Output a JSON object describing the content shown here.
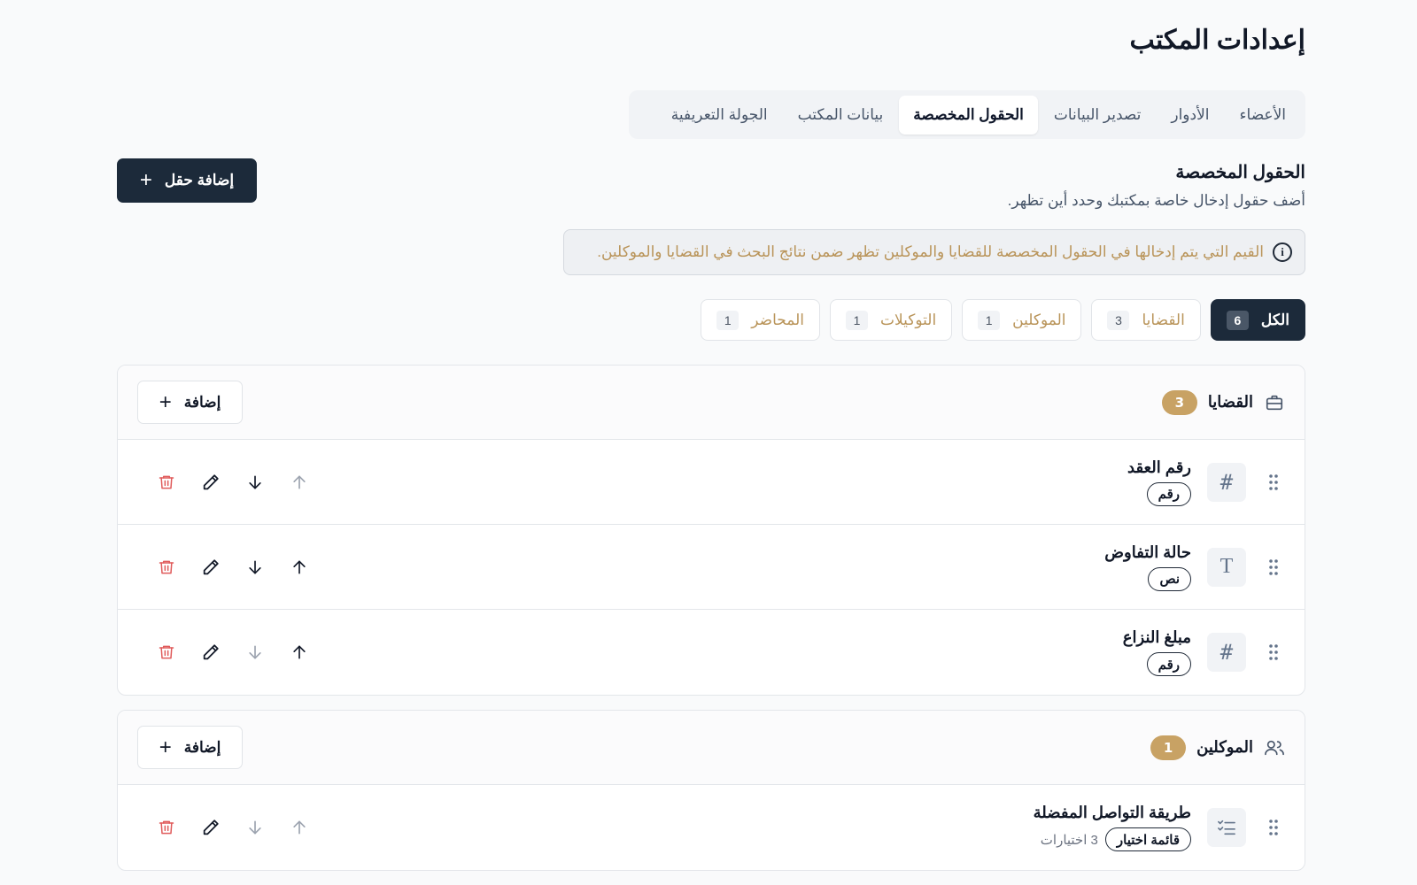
{
  "page": {
    "title": "إعدادات المكتب"
  },
  "tabs": [
    {
      "label": "الأعضاء",
      "active": false
    },
    {
      "label": "الأدوار",
      "active": false
    },
    {
      "label": "تصدير البيانات",
      "active": false
    },
    {
      "label": "الحقول المخصصة",
      "active": true
    },
    {
      "label": "بيانات المكتب",
      "active": false
    },
    {
      "label": "الجولة التعريفية",
      "active": false
    }
  ],
  "section": {
    "title": "الحقول المخصصة",
    "subtitle": "أضف حقول إدخال خاصة بمكتبك وحدد أين تظهر.",
    "add_button": "إضافة حقل"
  },
  "info": {
    "text": "القيم التي يتم إدخالها في الحقول المخصصة للقضايا والموكلين تظهر ضمن نتائج البحث في القضايا والموكلين."
  },
  "filters": [
    {
      "label": "الكل",
      "count": "6",
      "active": true
    },
    {
      "label": "القضايا",
      "count": "3",
      "active": false
    },
    {
      "label": "الموكلين",
      "count": "1",
      "active": false
    },
    {
      "label": "التوكيلات",
      "count": "1",
      "active": false
    },
    {
      "label": "المحاضر",
      "count": "1",
      "active": false
    }
  ],
  "groups": [
    {
      "title": "القضايا",
      "icon": "briefcase-icon",
      "count": "3",
      "add_label": "إضافة",
      "fields": [
        {
          "name": "رقم العقد",
          "type_label": "رقم",
          "type_icon": "hash-icon",
          "up_enabled": false,
          "down_enabled": true
        },
        {
          "name": "حالة التفاوض",
          "type_label": "نص",
          "type_icon": "text-type-icon",
          "up_enabled": true,
          "down_enabled": true
        },
        {
          "name": "مبلغ النزاع",
          "type_label": "رقم",
          "type_icon": "hash-icon",
          "up_enabled": true,
          "down_enabled": false
        }
      ]
    },
    {
      "title": "الموكلين",
      "icon": "users-icon",
      "count": "1",
      "add_label": "إضافة",
      "fields": [
        {
          "name": "طريقة التواصل المفضلة",
          "type_label": "قائمة اختيار",
          "type_icon": "list-check-icon",
          "options_note": "3 اختيارات",
          "up_enabled": false,
          "down_enabled": false
        }
      ]
    }
  ],
  "colors": {
    "primary": "#1c2a3a",
    "accent": "#c8a264",
    "accent_text": "#b99459",
    "danger": "#e05b5b"
  }
}
